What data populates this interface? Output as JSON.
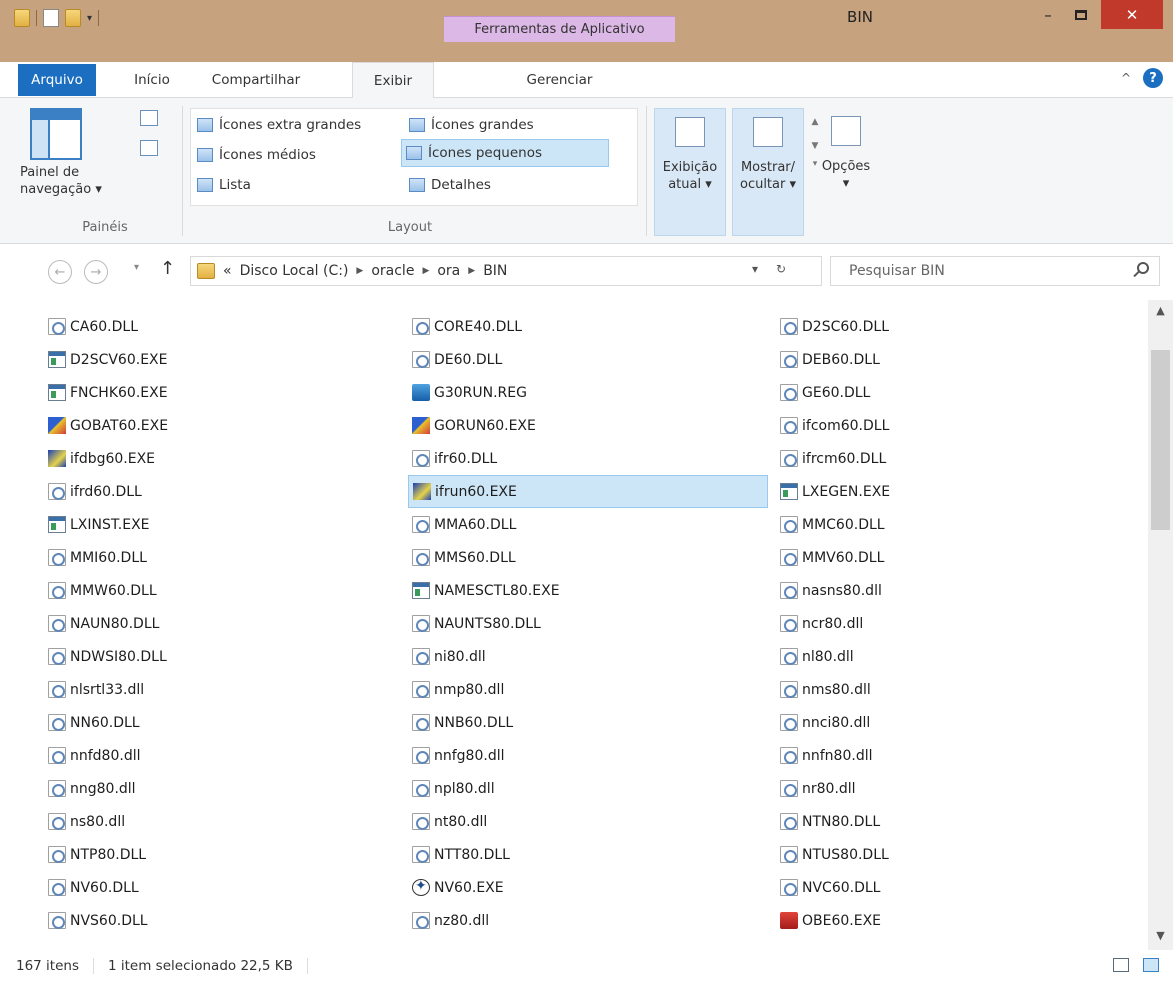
{
  "window": {
    "title": "BIN",
    "contextual_tab": "Ferramentas de Aplicativo",
    "controls": {
      "minimize": "–",
      "close": "✕"
    }
  },
  "ribbon_tabs": [
    "Arquivo",
    "Início",
    "Compartilhar",
    "Exibir",
    "Gerenciar"
  ],
  "ribbon": {
    "panes_group": {
      "nav_pane_label_1": "Painel de",
      "nav_pane_label_2": "navegação ▾",
      "group_label": "Painéis"
    },
    "layout_group": {
      "items": [
        "Ícones extra grandes",
        "Ícones grandes",
        "Ícones médios",
        "Ícones pequenos",
        "Lista",
        "Detalhes"
      ],
      "selected": "Ícones pequenos",
      "group_label": "Layout"
    },
    "view_buttons": [
      {
        "line1": "Exibição",
        "line2": "atual ▾"
      },
      {
        "line1": "Mostrar/",
        "line2": "ocultar ▾"
      },
      {
        "line1": "Opções",
        "line2": "▾"
      }
    ]
  },
  "address_bar": {
    "prefix": "«",
    "crumbs": [
      "Disco Local (C:)",
      "oracle",
      "ora",
      "BIN"
    ],
    "search_placeholder": "Pesquisar BIN"
  },
  "files": {
    "col1": [
      {
        "name": "CA60.DLL",
        "type": "dll"
      },
      {
        "name": "D2SCV60.EXE",
        "type": "exe"
      },
      {
        "name": "FNCHK60.EXE",
        "type": "exe"
      },
      {
        "name": "GOBAT60.EXE",
        "type": "oracle"
      },
      {
        "name": "ifdbg60.EXE",
        "type": "forms"
      },
      {
        "name": "ifrd60.DLL",
        "type": "dll"
      },
      {
        "name": "LXINST.EXE",
        "type": "exe"
      },
      {
        "name": "MMI60.DLL",
        "type": "dll"
      },
      {
        "name": "MMW60.DLL",
        "type": "dll"
      },
      {
        "name": "NAUN80.DLL",
        "type": "dll"
      },
      {
        "name": "NDWSI80.DLL",
        "type": "dll"
      },
      {
        "name": "nlsrtl33.dll",
        "type": "dll"
      },
      {
        "name": "NN60.DLL",
        "type": "dll"
      },
      {
        "name": "nnfd80.dll",
        "type": "dll"
      },
      {
        "name": "nng80.dll",
        "type": "dll"
      },
      {
        "name": "ns80.dll",
        "type": "dll"
      },
      {
        "name": "NTP80.DLL",
        "type": "dll"
      },
      {
        "name": "NV60.DLL",
        "type": "dll"
      },
      {
        "name": "NVS60.DLL",
        "type": "dll"
      }
    ],
    "col2": [
      {
        "name": "CORE40.DLL",
        "type": "dll"
      },
      {
        "name": "DE60.DLL",
        "type": "dll"
      },
      {
        "name": "G30RUN.REG",
        "type": "reg"
      },
      {
        "name": "GORUN60.EXE",
        "type": "oracle"
      },
      {
        "name": "ifr60.DLL",
        "type": "dll"
      },
      {
        "name": "ifrun60.EXE",
        "type": "forms",
        "selected": true
      },
      {
        "name": "MMA60.DLL",
        "type": "dll"
      },
      {
        "name": "MMS60.DLL",
        "type": "dll"
      },
      {
        "name": "NAMESCTL80.EXE",
        "type": "exe"
      },
      {
        "name": "NAUNTS80.DLL",
        "type": "dll"
      },
      {
        "name": "ni80.dll",
        "type": "dll"
      },
      {
        "name": "nmp80.dll",
        "type": "dll"
      },
      {
        "name": "NNB60.DLL",
        "type": "dll"
      },
      {
        "name": "nnfg80.dll",
        "type": "dll"
      },
      {
        "name": "npl80.dll",
        "type": "dll"
      },
      {
        "name": "nt80.dll",
        "type": "dll"
      },
      {
        "name": "NTT80.DLL",
        "type": "dll"
      },
      {
        "name": "NV60.EXE",
        "type": "compass"
      },
      {
        "name": "nz80.dll",
        "type": "dll"
      }
    ],
    "col3": [
      {
        "name": "D2SC60.DLL",
        "type": "dll"
      },
      {
        "name": "DEB60.DLL",
        "type": "dll"
      },
      {
        "name": "GE60.DLL",
        "type": "dll"
      },
      {
        "name": "ifcom60.DLL",
        "type": "dll"
      },
      {
        "name": "ifrcm60.DLL",
        "type": "dll"
      },
      {
        "name": "LXEGEN.EXE",
        "type": "exe"
      },
      {
        "name": "MMC60.DLL",
        "type": "dll"
      },
      {
        "name": "MMV60.DLL",
        "type": "dll"
      },
      {
        "name": "nasns80.dll",
        "type": "dll"
      },
      {
        "name": "ncr80.dll",
        "type": "dll"
      },
      {
        "name": "nl80.dll",
        "type": "dll"
      },
      {
        "name": "nms80.dll",
        "type": "dll"
      },
      {
        "name": "nnci80.dll",
        "type": "dll"
      },
      {
        "name": "nnfn80.dll",
        "type": "dll"
      },
      {
        "name": "nr80.dll",
        "type": "dll"
      },
      {
        "name": "NTN80.DLL",
        "type": "dll"
      },
      {
        "name": "NTUS80.DLL",
        "type": "dll"
      },
      {
        "name": "NVC60.DLL",
        "type": "dll"
      },
      {
        "name": "OBE60.EXE",
        "type": "obe"
      }
    ]
  },
  "status_bar": {
    "count": "167 itens",
    "selection": "1 item selecionado  22,5 KB"
  },
  "colors": {
    "titlebar": "#c6a27e",
    "file_tab": "#1c6ec0",
    "contextual_tab": "#dcb8e6",
    "selection": "#cde6f7",
    "close_button": "#c0392b"
  }
}
